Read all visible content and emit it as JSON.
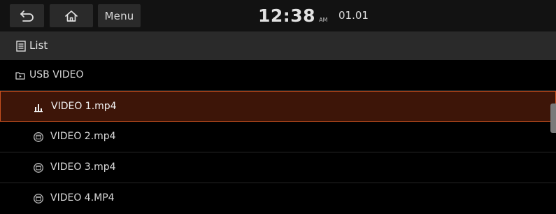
{
  "topbar": {
    "back_icon": "back-arrow-icon",
    "home_icon": "home-icon",
    "menu_label": "Menu",
    "clock_time": "12:38",
    "clock_ampm": "AM",
    "date": "01.01"
  },
  "titlebar": {
    "icon": "list-icon",
    "title": "List"
  },
  "list": {
    "folder": {
      "icon": "folder-video-icon",
      "label": "USB VIDEO"
    },
    "items": [
      {
        "label": "VIDEO 1.mp4",
        "icon": "playing-equalizer-icon",
        "selected": true
      },
      {
        "label": "VIDEO 2.mp4",
        "icon": "video-file-icon",
        "selected": false
      },
      {
        "label": "VIDEO 3.mp4",
        "icon": "video-file-icon",
        "selected": false
      },
      {
        "label": "VIDEO 4.MP4",
        "icon": "video-file-icon",
        "selected": false
      }
    ]
  },
  "colors": {
    "accent": "#c8501f",
    "selected_bg": "#3d1508",
    "topbar_bg": "#121212",
    "titlebar_bg": "#2a2a2a"
  }
}
